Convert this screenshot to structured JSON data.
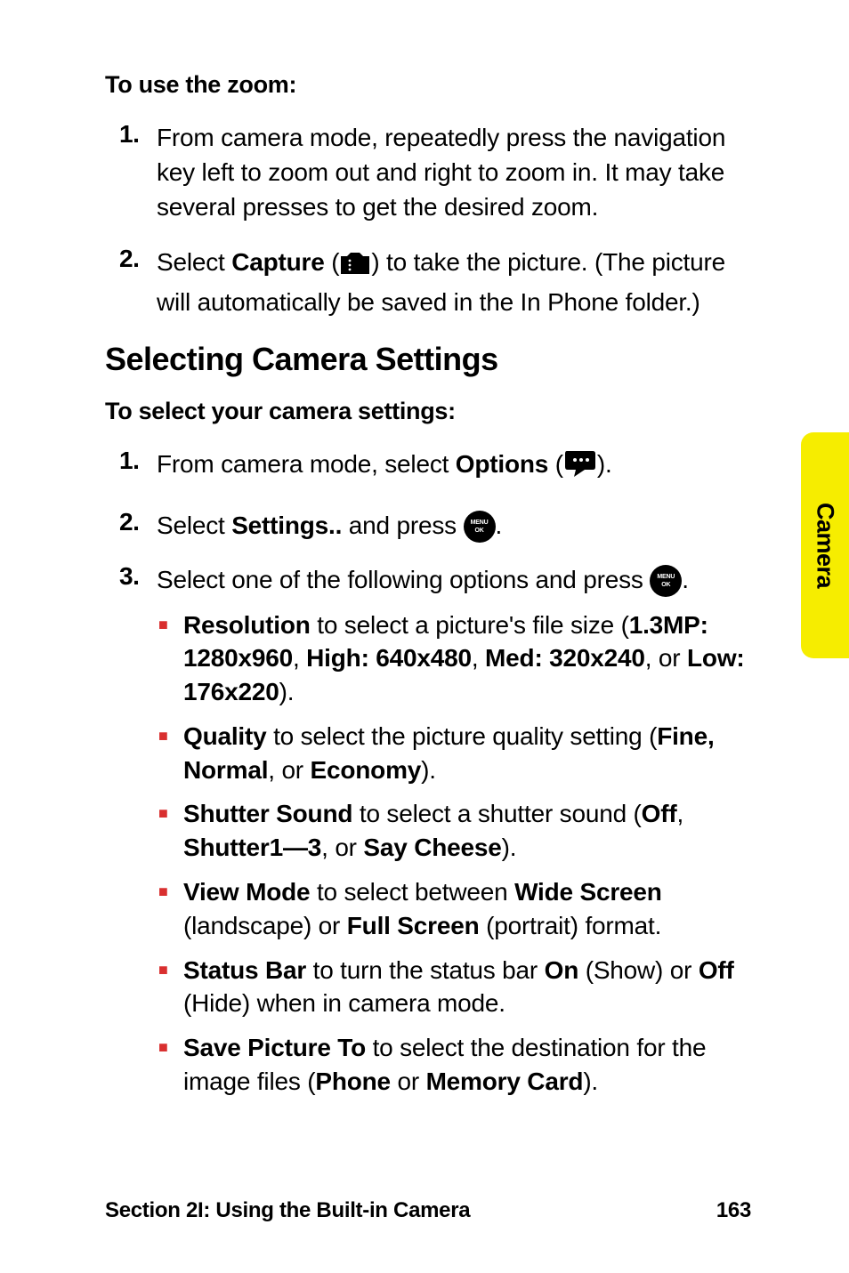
{
  "side_tab": {
    "label": "Camera"
  },
  "section_zoom": {
    "lede": "To use the zoom:",
    "items": [
      {
        "num": "1.",
        "text_before": "From camera mode, repeatedly press the navigation key left to zoom out and right to zoom in. It may take several presses to get the desired zoom."
      },
      {
        "num": "2.",
        "lead": "Select ",
        "bold1": "Capture",
        "after1": " (",
        "icon": "camera-icon",
        "after_icon": ") to take the picture. (The picture will automatically be saved in the In Phone folder.)"
      }
    ]
  },
  "section_settings": {
    "heading": "Selecting Camera Settings",
    "lede": "To select your camera settings:",
    "items": [
      {
        "num": "1.",
        "lead": "From camera mode, select ",
        "bold1": "Options",
        "after1": " (",
        "icon": "speech-icon",
        "after_icon": ")."
      },
      {
        "num": "2.",
        "lead": "Select ",
        "bold1": "Settings..",
        "after1": " and press ",
        "icon": "menu-ok-icon",
        "after_icon": "."
      },
      {
        "num": "3.",
        "lead": "Select one of the following options and press ",
        "icon": "menu-ok-icon",
        "after_icon": ".",
        "sub": [
          {
            "b": "Resolution",
            "a1": " to select a picture's file size (",
            "b2": "1.3MP: 1280x960",
            "a2": ", ",
            "b3": "High: 640x480",
            "a3": ", ",
            "b4": "Med: 320x240",
            "a4": ", or ",
            "b5": "Low: 176x220",
            "a5": ")."
          },
          {
            "b": "Quality",
            "a1": " to select the picture quality setting (",
            "b2": "Fine, Normal",
            "a2": ", or ",
            "b3": "Economy",
            "a3": ")."
          },
          {
            "b": "Shutter Sound",
            "a1": " to select a shutter sound (",
            "b2": "Off",
            "a2": ", ",
            "b3": "Shutter1—3",
            "a3": ", or ",
            "b4": "Say Cheese",
            "a4": ")."
          },
          {
            "b": "View Mode",
            "a1": " to select between ",
            "b2": "Wide Screen",
            "a2": " (landscape) or ",
            "b3": "Full Screen",
            "a3": " (portrait) format."
          },
          {
            "b": "Status Bar",
            "a1": " to turn the status bar ",
            "b2": "On",
            "a2": " (Show) or ",
            "b3": "Off",
            "a3": " (Hide) when in camera mode."
          },
          {
            "b": "Save Picture To",
            "a1": " to select the destination for the image files (",
            "b2": "Phone",
            "a2": " or ",
            "b3": "Memory Card",
            "a3": ")."
          }
        ]
      }
    ]
  },
  "footer": {
    "left": "Section 2I: Using the Built-in Camera",
    "right": "163"
  },
  "icons": {
    "menu_line1": "MENU",
    "menu_line2": "OK"
  }
}
